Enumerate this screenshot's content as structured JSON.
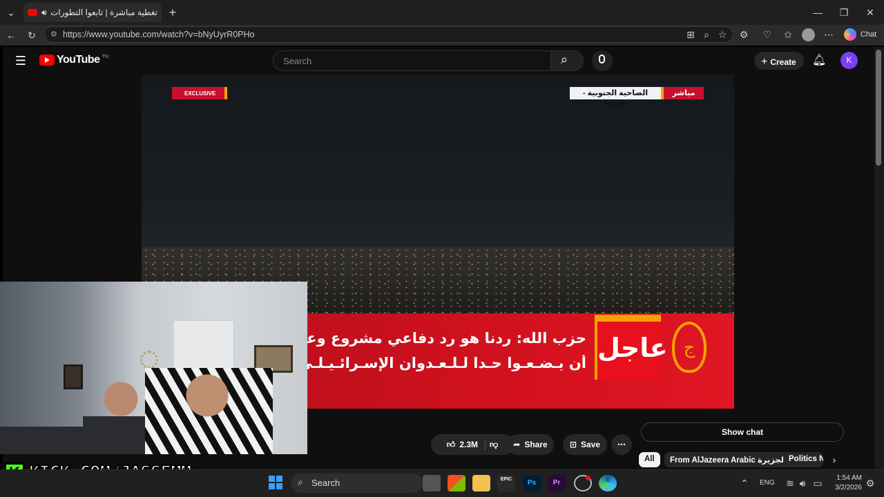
{
  "browser": {
    "tab_title": "تغطية مباشرة | تابعوا التطورات",
    "url": "https://www.youtube.com/watch?v=bNyUyrR0PHo",
    "chat_label": "Chat",
    "new_tab": "+"
  },
  "youtube": {
    "logo": "YouTube",
    "logo_sup": "TN",
    "search_placeholder": "Search",
    "create_label": "Create",
    "avatar_letter": "K"
  },
  "video": {
    "exclusive_tag": "EXCLUSIVE",
    "location": "الضاحية الجنوبية - بيروت",
    "live_label": "مباشر",
    "urgent_label": "عاجل",
    "ticker_line1": "حزب الله: ردنا هو رد دفاعي مشروع وعلى ال",
    "ticker_line2": "أن يـضـعـوا حـدا لـلـعـدوان الإسـرائـيـلـي الأ"
  },
  "stream_overlay": {
    "kick_label": "KICK.COM/JASSEMM",
    "kick_k": "K"
  },
  "actions": {
    "likes": "2.3M",
    "share": "Share",
    "save": "Save",
    "show_chat": "Show chat"
  },
  "chips": [
    {
      "label": "All"
    },
    {
      "label": "From AlJazeera Arabic قناة الجزيرة"
    },
    {
      "label": "Politics N"
    }
  ],
  "taskbar": {
    "search_label": "Search",
    "lang": "ENG",
    "time": "1:54 AM",
    "date": "3/2/2026"
  },
  "colors": {
    "aj_red": "#c8102e",
    "aj_gold": "#f3a300",
    "kick_green": "#53fc18",
    "yt_red": "#ff0000"
  }
}
